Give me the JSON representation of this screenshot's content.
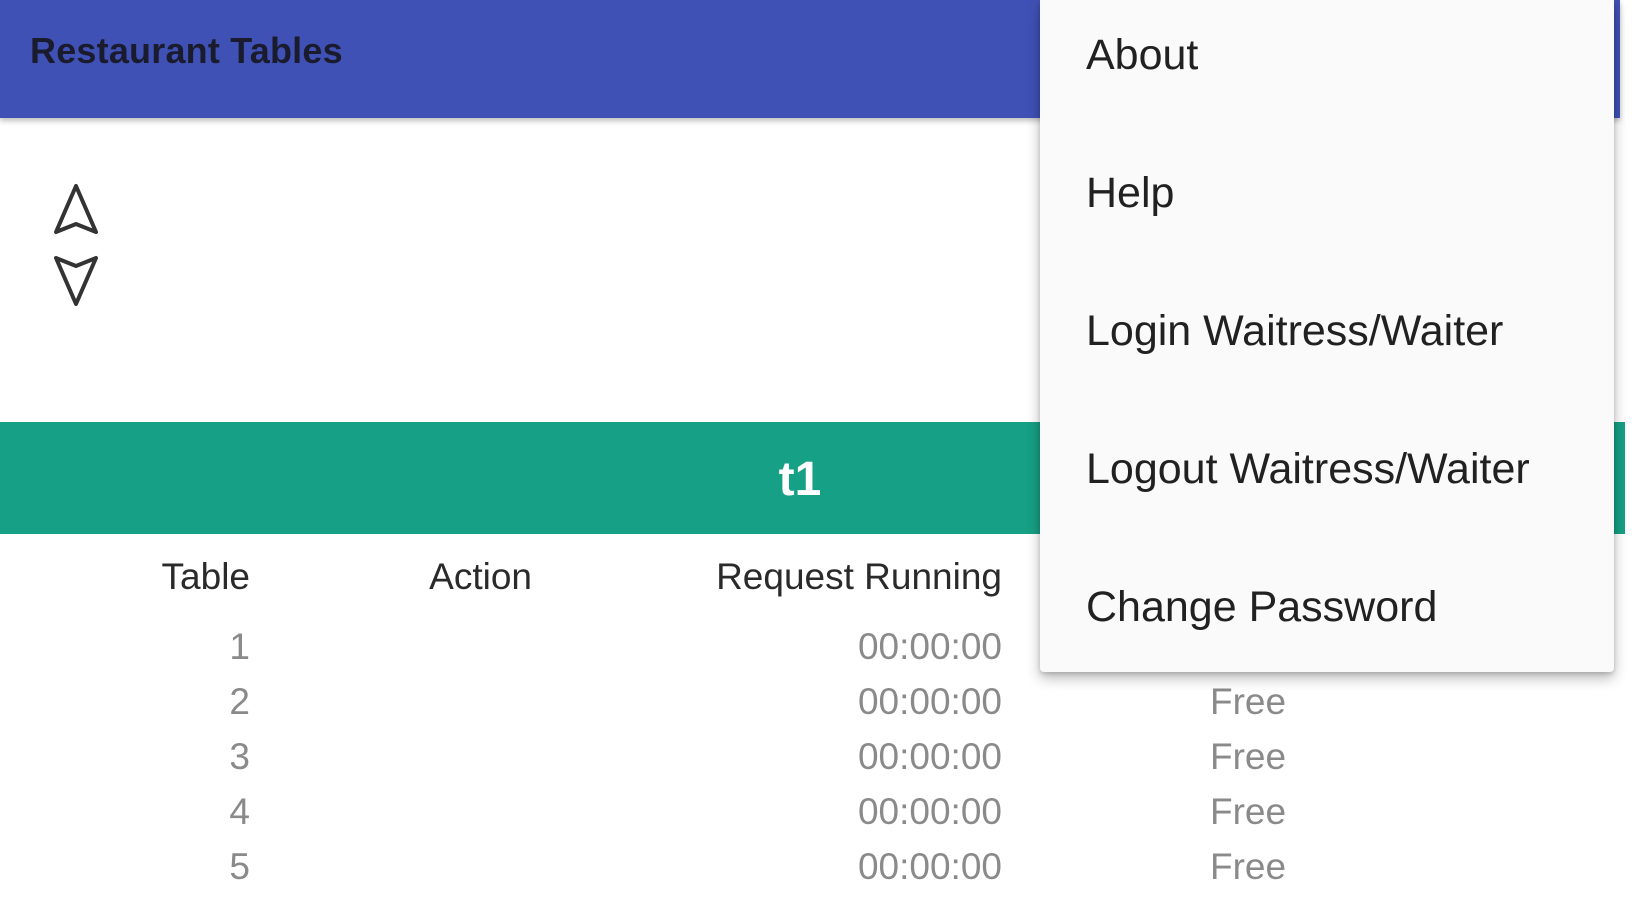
{
  "app_bar": {
    "title": "Restaurant Tables",
    "color": "#3f51b5"
  },
  "sort": {
    "up_icon": "triangle-up-outline-icon",
    "down_icon": "triangle-down-outline-icon"
  },
  "banner": {
    "label": "t1",
    "color": "#16a085"
  },
  "table": {
    "headers": {
      "table": "Table",
      "action": "Action",
      "request": "Request Running"
    },
    "rows": [
      {
        "number": "1",
        "time": "00:00:00",
        "status": ""
      },
      {
        "number": "2",
        "time": "00:00:00",
        "status": "Free"
      },
      {
        "number": "3",
        "time": "00:00:00",
        "status": "Free"
      },
      {
        "number": "4",
        "time": "00:00:00",
        "status": "Free"
      },
      {
        "number": "5",
        "time": "00:00:00",
        "status": "Free"
      }
    ]
  },
  "menu": {
    "items": [
      {
        "label": "About"
      },
      {
        "label": "Help"
      },
      {
        "label": "Login Waitress/Waiter"
      },
      {
        "label": "Logout Waitress/Waiter"
      },
      {
        "label": "Change Password"
      }
    ]
  }
}
